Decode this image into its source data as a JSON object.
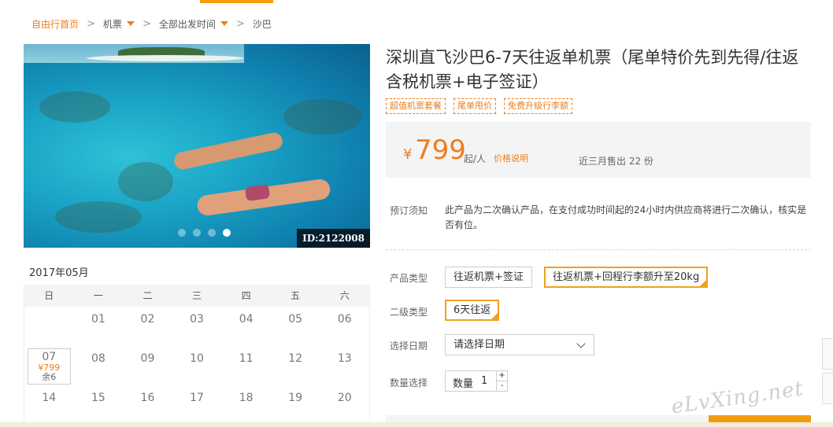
{
  "breadcrumb": {
    "home": "自由行首页",
    "sep": ">",
    "category": "机票",
    "departure": "全部出发时间",
    "destination": "沙巴"
  },
  "photo": {
    "id_badge": "ID:2122008",
    "slides": 4,
    "active_slide": 4
  },
  "product": {
    "title": "深圳直飞沙巴6-7天往返单机票（尾单特价先到先得/往返含税机票+电子签证）",
    "tags": [
      "超值机票套餐",
      "尾单甩价",
      "免费升级行李额"
    ]
  },
  "price": {
    "currency": "¥",
    "amount": "799",
    "per": "起/人",
    "explain": "价格说明",
    "sold": "近三月售出 22 份"
  },
  "notice": {
    "label": "预订须知",
    "text": "此产品为二次确认产品，在支付成功时间起的24小时内供应商将进行二次确认，核实是否有位。"
  },
  "options": {
    "product_type_label": "产品类型",
    "product_types": [
      "往返机票+签证",
      "往返机票+回程行李额升至20kg"
    ],
    "sub_type_label": "二级类型",
    "sub_type": "6天往返",
    "date_label": "选择日期",
    "date_placeholder": "请选择日期",
    "qty_label": "数量选择",
    "qty_field_label": "数量",
    "qty_value": "1",
    "plus": "+",
    "minus": "-"
  },
  "calendar": {
    "month": "2017年05月",
    "weekdays": [
      "日",
      "一",
      "二",
      "三",
      "四",
      "五",
      "六"
    ],
    "row1": [
      "",
      "01",
      "02",
      "03",
      "04",
      "05",
      "06"
    ],
    "avail_day": "07",
    "avail_price": "¥799",
    "avail_remain": "余6",
    "row2_rest": [
      "08",
      "09",
      "10",
      "11",
      "12",
      "13"
    ],
    "row3": [
      "14",
      "15",
      "16",
      "17",
      "18",
      "19",
      "20"
    ]
  },
  "watermark": "eLvXing.net",
  "colors": {
    "accent": "#ee7d1a",
    "selected_border": "#f0a020"
  }
}
